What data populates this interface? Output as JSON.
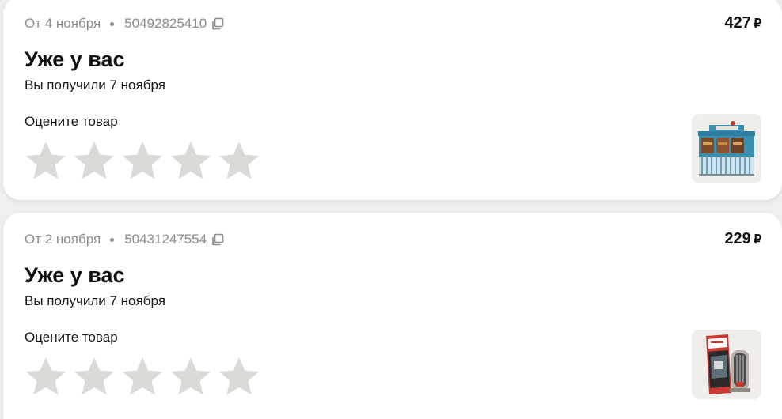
{
  "orders": [
    {
      "date": "От 4 ноября",
      "number": "50492825410",
      "price": "427",
      "currency": "₽",
      "status": "Уже у вас",
      "received": "Вы получили 7 ноября",
      "rate_label": "Оцените товар",
      "rating": 0,
      "rating_max": 5,
      "thumbnail": "product-kiosk-model-image"
    },
    {
      "date": "От 2 ноября",
      "number": "50431247554",
      "price": "229",
      "currency": "₽",
      "status": "Уже у вас",
      "received": "Вы получили 7 ноября",
      "rate_label": "Оцените товар",
      "rating": 0,
      "rating_max": 5,
      "thumbnail": "product-package-image"
    }
  ],
  "icons": {
    "copy": "copy-icon",
    "star": "star-icon"
  },
  "colors": {
    "star_empty": "#dcdad7",
    "muted_text": "#8c8c8c",
    "card_bg": "#ffffff",
    "page_bg": "#efefef"
  }
}
